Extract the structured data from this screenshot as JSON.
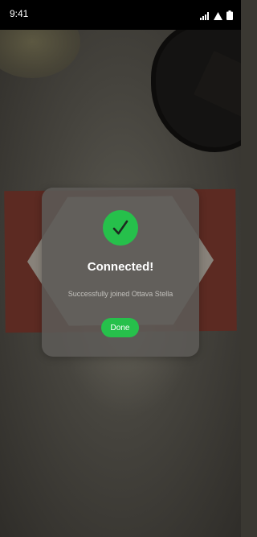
{
  "status_bar": {
    "time": "9:41",
    "icons": [
      "signal-icon",
      "wifi-icon",
      "battery-icon"
    ]
  },
  "dialog": {
    "icon": "checkmark-icon",
    "title": "Connected!",
    "message": "Successfully joined Ottava Stella",
    "done_label": "Done"
  },
  "colors": {
    "accent": "#26c04b",
    "dialog_bg": "#5c5a56",
    "status_bar_bg": "#000000"
  }
}
